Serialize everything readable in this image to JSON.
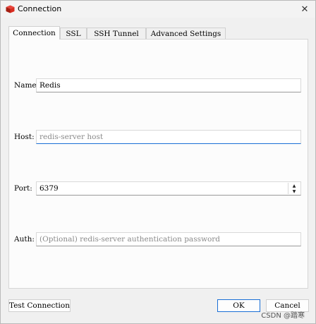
{
  "window": {
    "title": "Connection",
    "close_glyph": "✕",
    "app_icon": "redis-logo-icon",
    "accent_color": "#d82c20"
  },
  "tabs": [
    {
      "label": "Connection",
      "active": true
    },
    {
      "label": "SSL",
      "active": false
    },
    {
      "label": "SSH Tunnel",
      "active": false
    },
    {
      "label": "Advanced Settings",
      "active": false
    }
  ],
  "form": {
    "name": {
      "label": "Name",
      "value": "Redis",
      "placeholder": ""
    },
    "host": {
      "label": "Host:",
      "value": "",
      "placeholder": "redis-server host"
    },
    "port": {
      "label": "Port:",
      "value": "6379",
      "placeholder": ""
    },
    "auth": {
      "label": "Auth:",
      "value": "",
      "placeholder": "(Optional) redis-server authentication password"
    }
  },
  "buttons": {
    "test_connection": "Test Connection",
    "ok": "OK",
    "cancel": "Cancel"
  },
  "spin": {
    "up": "▲",
    "down": "▼"
  },
  "watermark": "CSDN @踏寒"
}
